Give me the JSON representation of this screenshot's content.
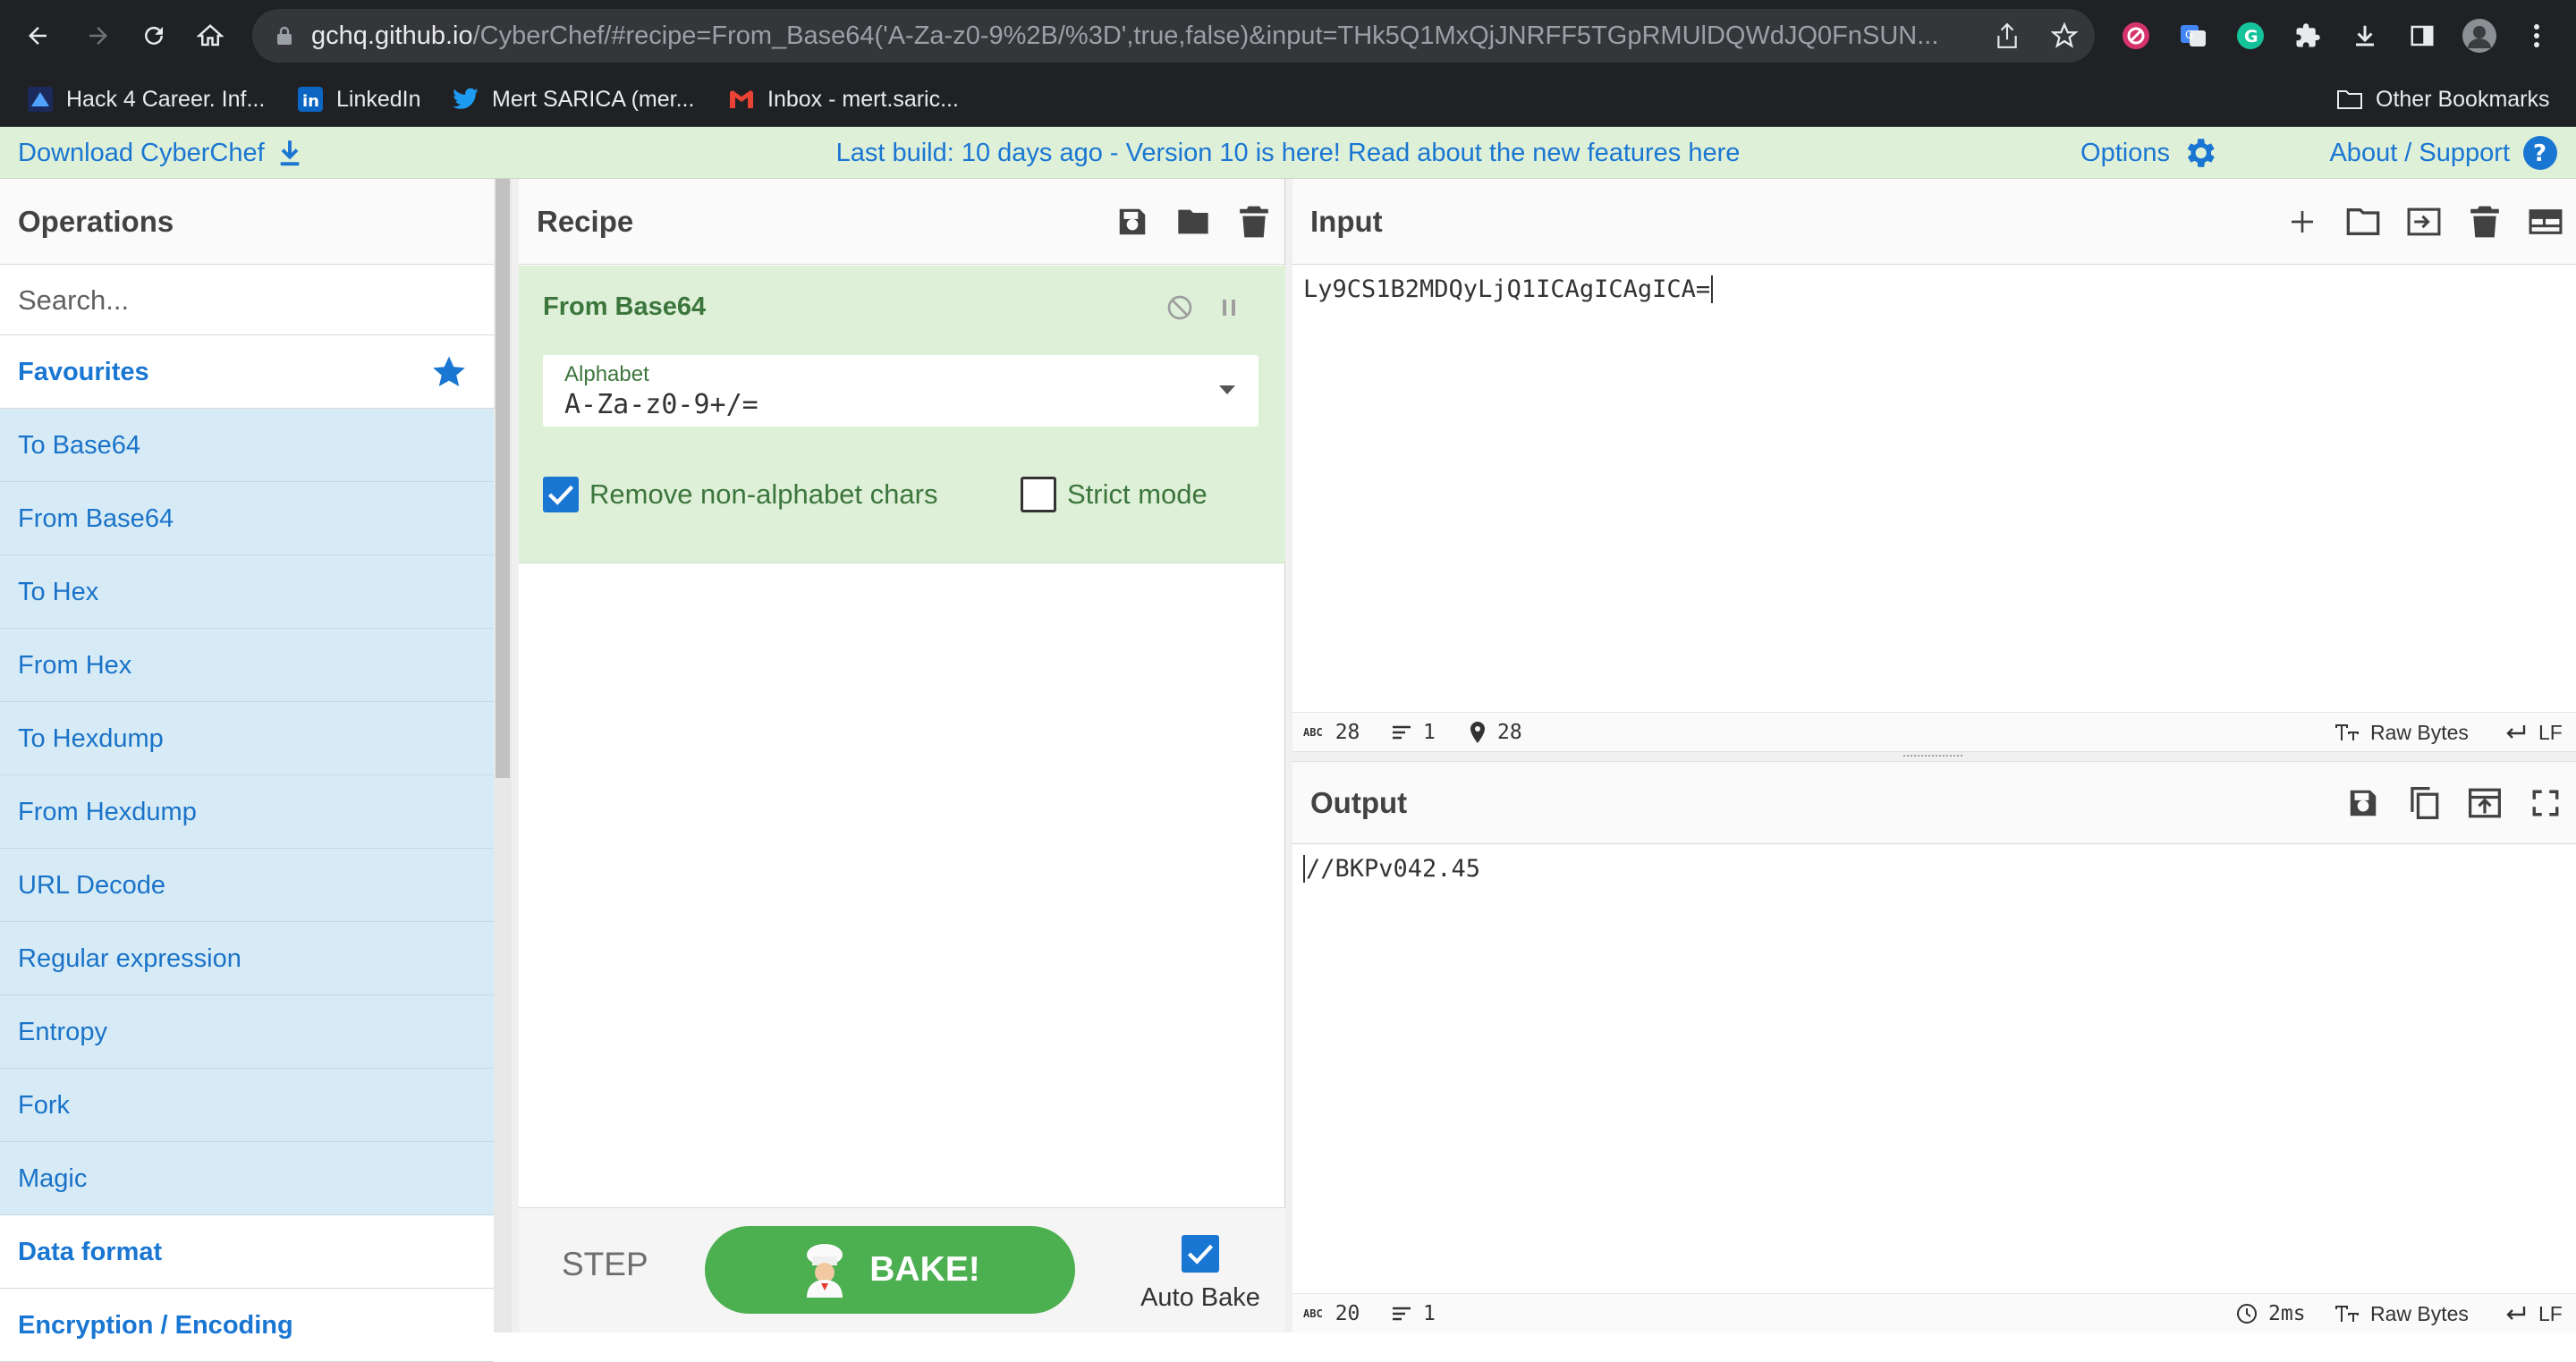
{
  "browser": {
    "url_host": "gchq.github.io",
    "url_rest": "/CyberChef/#recipe=From_Base64('A-Za-z0-9%2B/%3D',true,false)&input=THk5Q1MxQjJNRFF5TGpRMUlDQWdJQ0FnSUN...",
    "bookmarks": [
      {
        "label": "Hack 4 Career. Inf...",
        "icon": "hack4career-icon"
      },
      {
        "label": "LinkedIn",
        "icon": "linkedin-icon"
      },
      {
        "label": "Mert SARICA (mer...",
        "icon": "twitter-icon"
      },
      {
        "label": "Inbox - mert.saric...",
        "icon": "gmail-icon"
      }
    ],
    "other_bookmarks": "Other Bookmarks"
  },
  "banner": {
    "download": "Download CyberChef",
    "message": "Last build: 10 days ago - Version 10 is here! Read about the new features ",
    "message_link": "here",
    "options": "Options",
    "about": "About / Support"
  },
  "operations": {
    "title": "Operations",
    "search_placeholder": "Search...",
    "favourites": "Favourites",
    "items": [
      "To Base64",
      "From Base64",
      "To Hex",
      "From Hex",
      "To Hexdump",
      "From Hexdump",
      "URL Decode",
      "Regular expression",
      "Entropy",
      "Fork",
      "Magic"
    ],
    "categories": [
      "Data format",
      "Encryption / Encoding"
    ]
  },
  "recipe": {
    "title": "Recipe",
    "op_name": "From Base64",
    "arg_label": "Alphabet",
    "arg_value": "A-Za-z0-9+/=",
    "check1_label": "Remove non-alphabet chars",
    "check1_checked": true,
    "check2_label": "Strict mode",
    "check2_checked": false,
    "step_label": "STEP",
    "bake_label": "BAKE!",
    "autobake_label": "Auto Bake",
    "autobake_checked": true
  },
  "input": {
    "title": "Input",
    "text": "Ly9CS1B2MDQyLjQ1ICAgICAgICA=",
    "status_chars": "28",
    "status_lines": "1",
    "status_pos": "28",
    "encoding": "Raw Bytes",
    "eol": "LF"
  },
  "output": {
    "title": "Output",
    "text": "//BKPv042.45",
    "status_chars": "20",
    "status_lines": "1",
    "time": "2ms",
    "encoding": "Raw Bytes",
    "eol": "LF"
  },
  "colors": {
    "accent": "#1976d2",
    "recipe_green": "#dff0d8",
    "recipe_text": "#3c763d",
    "op_bg": "#d7ebf6",
    "bake": "#4caf50"
  }
}
